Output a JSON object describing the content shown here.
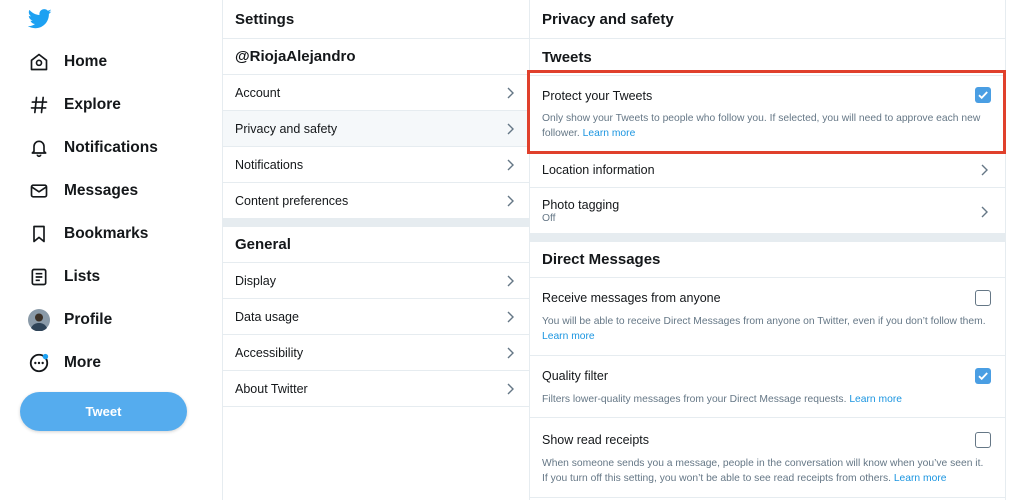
{
  "nav": {
    "items": [
      {
        "label": "Home",
        "icon": "home-icon"
      },
      {
        "label": "Explore",
        "icon": "hashtag-icon"
      },
      {
        "label": "Notifications",
        "icon": "bell-icon"
      },
      {
        "label": "Messages",
        "icon": "envelope-icon"
      },
      {
        "label": "Bookmarks",
        "icon": "bookmark-icon"
      },
      {
        "label": "Lists",
        "icon": "list-icon"
      },
      {
        "label": "Profile",
        "icon": "avatar"
      },
      {
        "label": "More",
        "icon": "more-icon"
      }
    ],
    "tweet_label": "Tweet"
  },
  "settings": {
    "title": "Settings",
    "account_handle": "@RiojaAlejandro",
    "account_items": [
      "Account",
      "Privacy and safety",
      "Notifications",
      "Content preferences"
    ],
    "general_title": "General",
    "general_items": [
      "Display",
      "Data usage",
      "Accessibility",
      "About Twitter"
    ]
  },
  "privacy": {
    "title": "Privacy and safety",
    "tweets_section": "Tweets",
    "protect_title": "Protect your Tweets",
    "protect_desc": "Only show your Tweets to people who follow you. If selected, you will need to approve each new follower.",
    "protect_checked": true,
    "location_title": "Location information",
    "photo_title": "Photo tagging",
    "photo_sub": "Off",
    "dm_section": "Direct Messages",
    "receive_title": "Receive messages from anyone",
    "receive_desc": "You will be able to receive Direct Messages from anyone on Twitter, even if you don’t follow them.",
    "receive_checked": false,
    "quality_title": "Quality filter",
    "quality_desc": "Filters lower-quality messages from your Direct Message requests.",
    "quality_checked": true,
    "receipts_title": "Show read receipts",
    "receipts_desc": "When someone sends you a message, people in the conversation will know when you’ve seen it. If you turn off this setting, you won’t be able to see read receipts from others.",
    "receipts_checked": false,
    "learn_more": "Learn more"
  },
  "colors": {
    "brand": "#1da1f2",
    "tweet_button": "#55acee",
    "checkbox_checked": "#4a9ee3",
    "link": "#1b95e0",
    "highlight": "#e0402c"
  }
}
